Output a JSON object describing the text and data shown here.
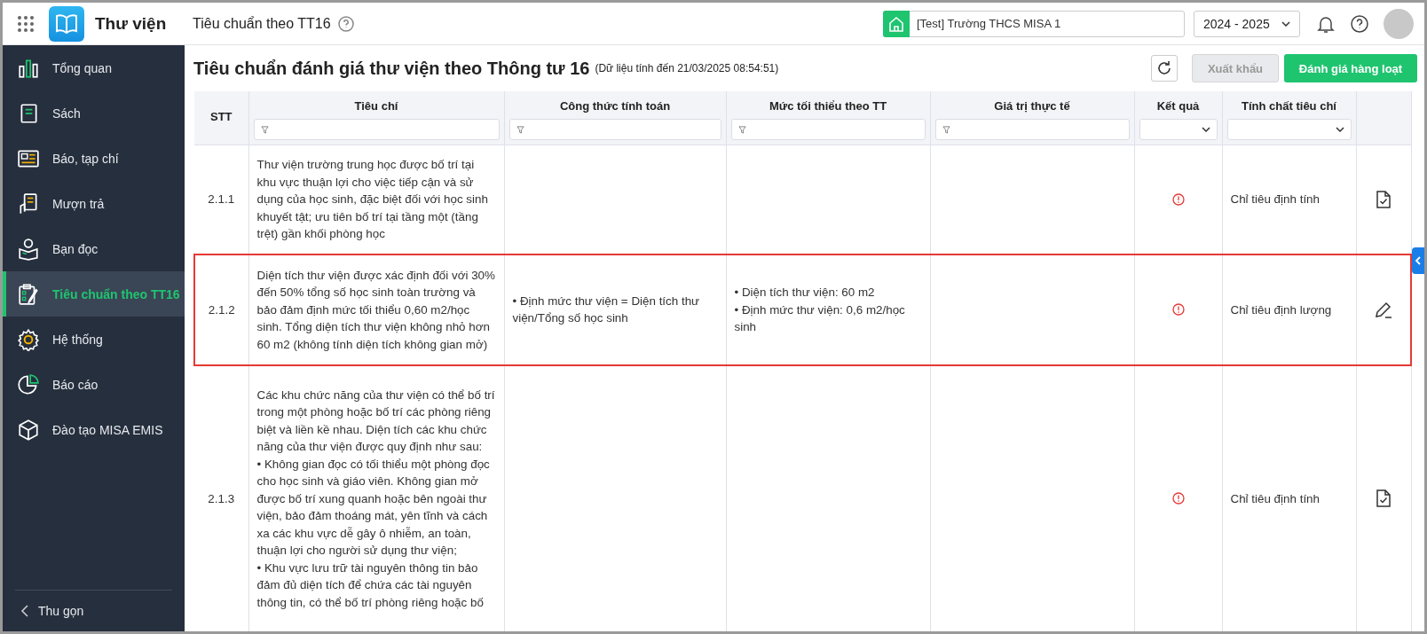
{
  "app": {
    "name": "Thư viện",
    "page_title": "Tiêu chuẩn theo TT16"
  },
  "header": {
    "school": "[Test] Trường THCS MISA 1",
    "year": "2024 - 2025"
  },
  "sidebar": {
    "items": [
      {
        "label": "Tổng quan",
        "selected": false
      },
      {
        "label": "Sách",
        "selected": false
      },
      {
        "label": "Báo, tạp chí",
        "selected": false
      },
      {
        "label": "Mượn trả",
        "selected": false
      },
      {
        "label": "Bạn đọc",
        "selected": false
      },
      {
        "label": "Tiêu chuẩn theo TT16",
        "selected": true
      },
      {
        "label": "Hệ thống",
        "selected": false
      },
      {
        "label": "Báo cáo",
        "selected": false
      },
      {
        "label": "Đào tạo MISA EMIS",
        "selected": false
      }
    ],
    "collapse": "Thu gọn"
  },
  "content": {
    "title": "Tiêu chuẩn đánh giá thư viện theo Thông tư 16",
    "subtitle": "(Dữ liệu tính đến 21/03/2025 08:54:51)",
    "buttons": [
      {
        "label": "Xuất khẩu",
        "disabled": true
      },
      {
        "label": "Đánh giá hàng loạt",
        "disabled": false
      }
    ]
  },
  "table": {
    "columns": [
      {
        "label": "STT",
        "kind": "plain"
      },
      {
        "label": "Tiêu chí",
        "kind": "text"
      },
      {
        "label": "Công thức tính toán",
        "kind": "text"
      },
      {
        "label": "Mức tối thiểu theo TT",
        "kind": "text"
      },
      {
        "label": "Giá trị thực tế",
        "kind": "text"
      },
      {
        "label": "Kết quả",
        "kind": "select"
      },
      {
        "label": "Tính chất tiêu chí",
        "kind": "select"
      }
    ],
    "rows": [
      {
        "stt": "2.1.1",
        "criterion": "Thư viện trường trung học được bố trí tại khu vực thuận lợi cho việc tiếp cận và sử dụng của học sinh, đặc biệt đối với học sinh khuyết tật; ưu tiên bố trí tại tầng một (tầng trệt) gần khối phòng học",
        "formula": "",
        "minimum": "",
        "actual": "",
        "passed": false,
        "nature": "Chỉ tiêu định tính",
        "kind": "qualitative",
        "selected": false
      },
      {
        "stt": "2.1.2",
        "criterion": "Diện tích thư viện được xác định đối với 30% đến 50% tổng số học sinh toàn trường và bảo đảm định mức tối thiểu 0,60 m2/học sinh. Tổng diện tích thư viện không nhỏ hơn 60 m2 (không tính diện tích không gian mở)",
        "formula": "• Định mức thư viện = Diện tích thư viện/Tổng số học sinh",
        "minimum": "• Diện tích thư viện: 60 m2\n• Định mức thư viện: 0,6 m2/học sinh",
        "actual": "",
        "passed": false,
        "nature": "Chỉ tiêu định lượng",
        "kind": "quantitative",
        "selected": true
      },
      {
        "stt": "2.1.3",
        "criterion": "Các khu chức năng của thư viện có thể bố trí trong một phòng hoặc bố trí các phòng riêng biệt và liền kề nhau. Diện tích các khu chức năng của thư viện được quy định như sau:\n• Không gian đọc có tối thiểu một phòng đọc cho học sinh và giáo viên. Không gian mở được bố trí xung quanh hoặc bên ngoài thư viện, bảo đảm thoáng mát, yên tĩnh và cách xa các khu vực dễ gây ô nhiễm, an toàn, thuận lợi cho người sử dụng thư viện;\n• Khu vực lưu trữ tài nguyên thông tin bảo đảm đủ diện tích để chứa các tài nguyên thông tin, có thể bố trí phòng riêng hoặc bố",
        "formula": "",
        "minimum": "",
        "actual": "",
        "passed": false,
        "nature": "Chỉ tiêu định tính",
        "kind": "qualitative",
        "selected": false
      }
    ]
  }
}
